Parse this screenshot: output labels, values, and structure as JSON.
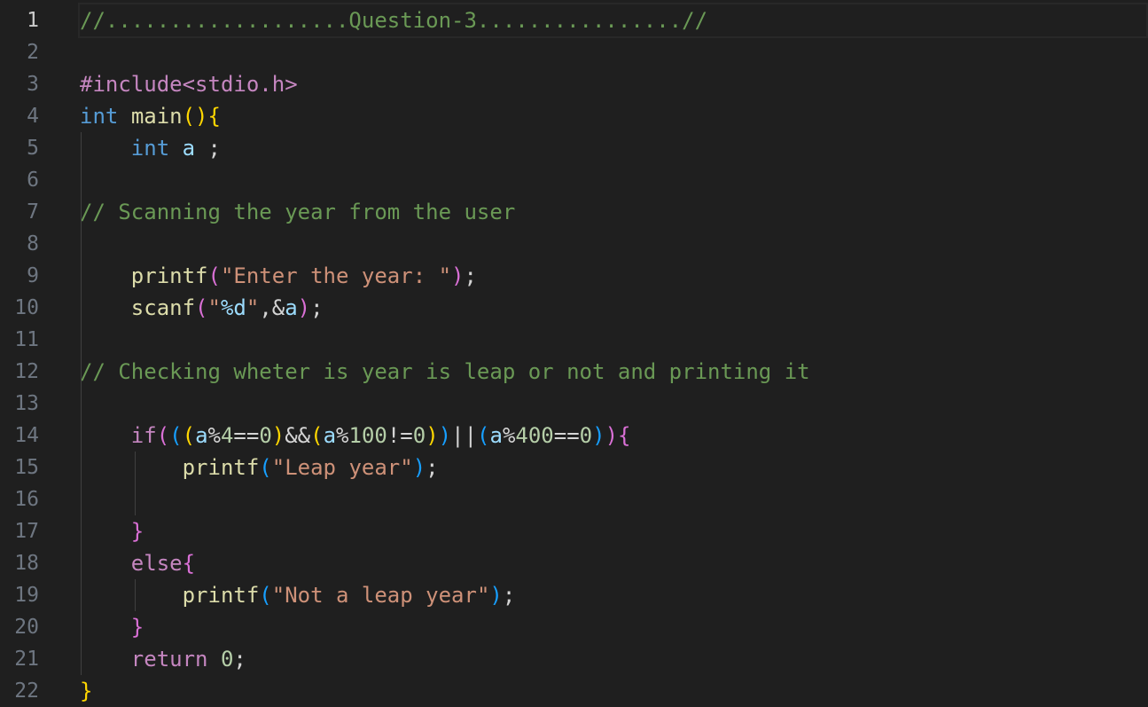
{
  "editor": {
    "active_line": 1,
    "line_numbers": [
      "1",
      "2",
      "3",
      "4",
      "5",
      "6",
      "7",
      "8",
      "9",
      "10",
      "11",
      "12",
      "13",
      "14",
      "15",
      "16",
      "17",
      "18",
      "19",
      "20",
      "21",
      "22"
    ],
    "lines": [
      [
        {
          "t": "//...................Question-3................//",
          "c": "comment"
        }
      ],
      [],
      [
        {
          "t": "#include<stdio.h>",
          "c": "pp"
        }
      ],
      [
        {
          "t": "int",
          "c": "keyword"
        },
        {
          "t": " ",
          "c": "op"
        },
        {
          "t": "main",
          "c": "func"
        },
        {
          "t": "()",
          "c": "b1"
        },
        {
          "t": "{",
          "c": "b1"
        }
      ],
      [
        {
          "t": "    ",
          "c": "op"
        },
        {
          "t": "int",
          "c": "keyword"
        },
        {
          "t": " ",
          "c": "op"
        },
        {
          "t": "a",
          "c": "var"
        },
        {
          "t": " ;",
          "c": "op"
        }
      ],
      [],
      [
        {
          "t": "// Scanning the year from the user",
          "c": "comment"
        }
      ],
      [],
      [
        {
          "t": "    ",
          "c": "op"
        },
        {
          "t": "printf",
          "c": "func"
        },
        {
          "t": "(",
          "c": "b2"
        },
        {
          "t": "\"Enter the year: \"",
          "c": "str"
        },
        {
          "t": ")",
          "c": "b2"
        },
        {
          "t": ";",
          "c": "op"
        }
      ],
      [
        {
          "t": "    ",
          "c": "op"
        },
        {
          "t": "scanf",
          "c": "func"
        },
        {
          "t": "(",
          "c": "b2"
        },
        {
          "t": "\"",
          "c": "str"
        },
        {
          "t": "%d",
          "c": "fmt"
        },
        {
          "t": "\"",
          "c": "str"
        },
        {
          "t": ",&",
          "c": "op"
        },
        {
          "t": "a",
          "c": "var"
        },
        {
          "t": ")",
          "c": "b2"
        },
        {
          "t": ";",
          "c": "op"
        }
      ],
      [],
      [
        {
          "t": "// Checking wheter is year is leap or not and printing it",
          "c": "comment"
        }
      ],
      [],
      [
        {
          "t": "    ",
          "c": "op"
        },
        {
          "t": "if",
          "c": "pp"
        },
        {
          "t": "(",
          "c": "b2"
        },
        {
          "t": "(",
          "c": "b3"
        },
        {
          "t": "(",
          "c": "b1"
        },
        {
          "t": "a",
          "c": "var"
        },
        {
          "t": "%",
          "c": "op"
        },
        {
          "t": "4",
          "c": "num"
        },
        {
          "t": "==",
          "c": "op"
        },
        {
          "t": "0",
          "c": "num"
        },
        {
          "t": ")",
          "c": "b1"
        },
        {
          "t": "&&",
          "c": "op"
        },
        {
          "t": "(",
          "c": "b1"
        },
        {
          "t": "a",
          "c": "var"
        },
        {
          "t": "%",
          "c": "op"
        },
        {
          "t": "100",
          "c": "num"
        },
        {
          "t": "!=",
          "c": "op"
        },
        {
          "t": "0",
          "c": "num"
        },
        {
          "t": ")",
          "c": "b1"
        },
        {
          "t": ")",
          "c": "b3"
        },
        {
          "t": "||",
          "c": "op"
        },
        {
          "t": "(",
          "c": "b3"
        },
        {
          "t": "a",
          "c": "var"
        },
        {
          "t": "%",
          "c": "op"
        },
        {
          "t": "400",
          "c": "num"
        },
        {
          "t": "==",
          "c": "op"
        },
        {
          "t": "0",
          "c": "num"
        },
        {
          "t": ")",
          "c": "b3"
        },
        {
          "t": ")",
          "c": "b2"
        },
        {
          "t": "{",
          "c": "b2"
        }
      ],
      [
        {
          "t": "        ",
          "c": "op"
        },
        {
          "t": "printf",
          "c": "func"
        },
        {
          "t": "(",
          "c": "b3"
        },
        {
          "t": "\"Leap year\"",
          "c": "str"
        },
        {
          "t": ")",
          "c": "b3"
        },
        {
          "t": ";",
          "c": "op"
        }
      ],
      [],
      [
        {
          "t": "    ",
          "c": "op"
        },
        {
          "t": "}",
          "c": "b2"
        }
      ],
      [
        {
          "t": "    ",
          "c": "op"
        },
        {
          "t": "else",
          "c": "pp"
        },
        {
          "t": "{",
          "c": "b2"
        }
      ],
      [
        {
          "t": "        ",
          "c": "op"
        },
        {
          "t": "printf",
          "c": "func"
        },
        {
          "t": "(",
          "c": "b3"
        },
        {
          "t": "\"Not a leap year\"",
          "c": "str"
        },
        {
          "t": ")",
          "c": "b3"
        },
        {
          "t": ";",
          "c": "op"
        }
      ],
      [
        {
          "t": "    ",
          "c": "op"
        },
        {
          "t": "}",
          "c": "b2"
        }
      ],
      [
        {
          "t": "    ",
          "c": "op"
        },
        {
          "t": "return",
          "c": "pp"
        },
        {
          "t": " ",
          "c": "op"
        },
        {
          "t": "0",
          "c": "num"
        },
        {
          "t": ";",
          "c": "op"
        }
      ],
      [
        {
          "t": "}",
          "c": "b1"
        }
      ]
    ]
  }
}
